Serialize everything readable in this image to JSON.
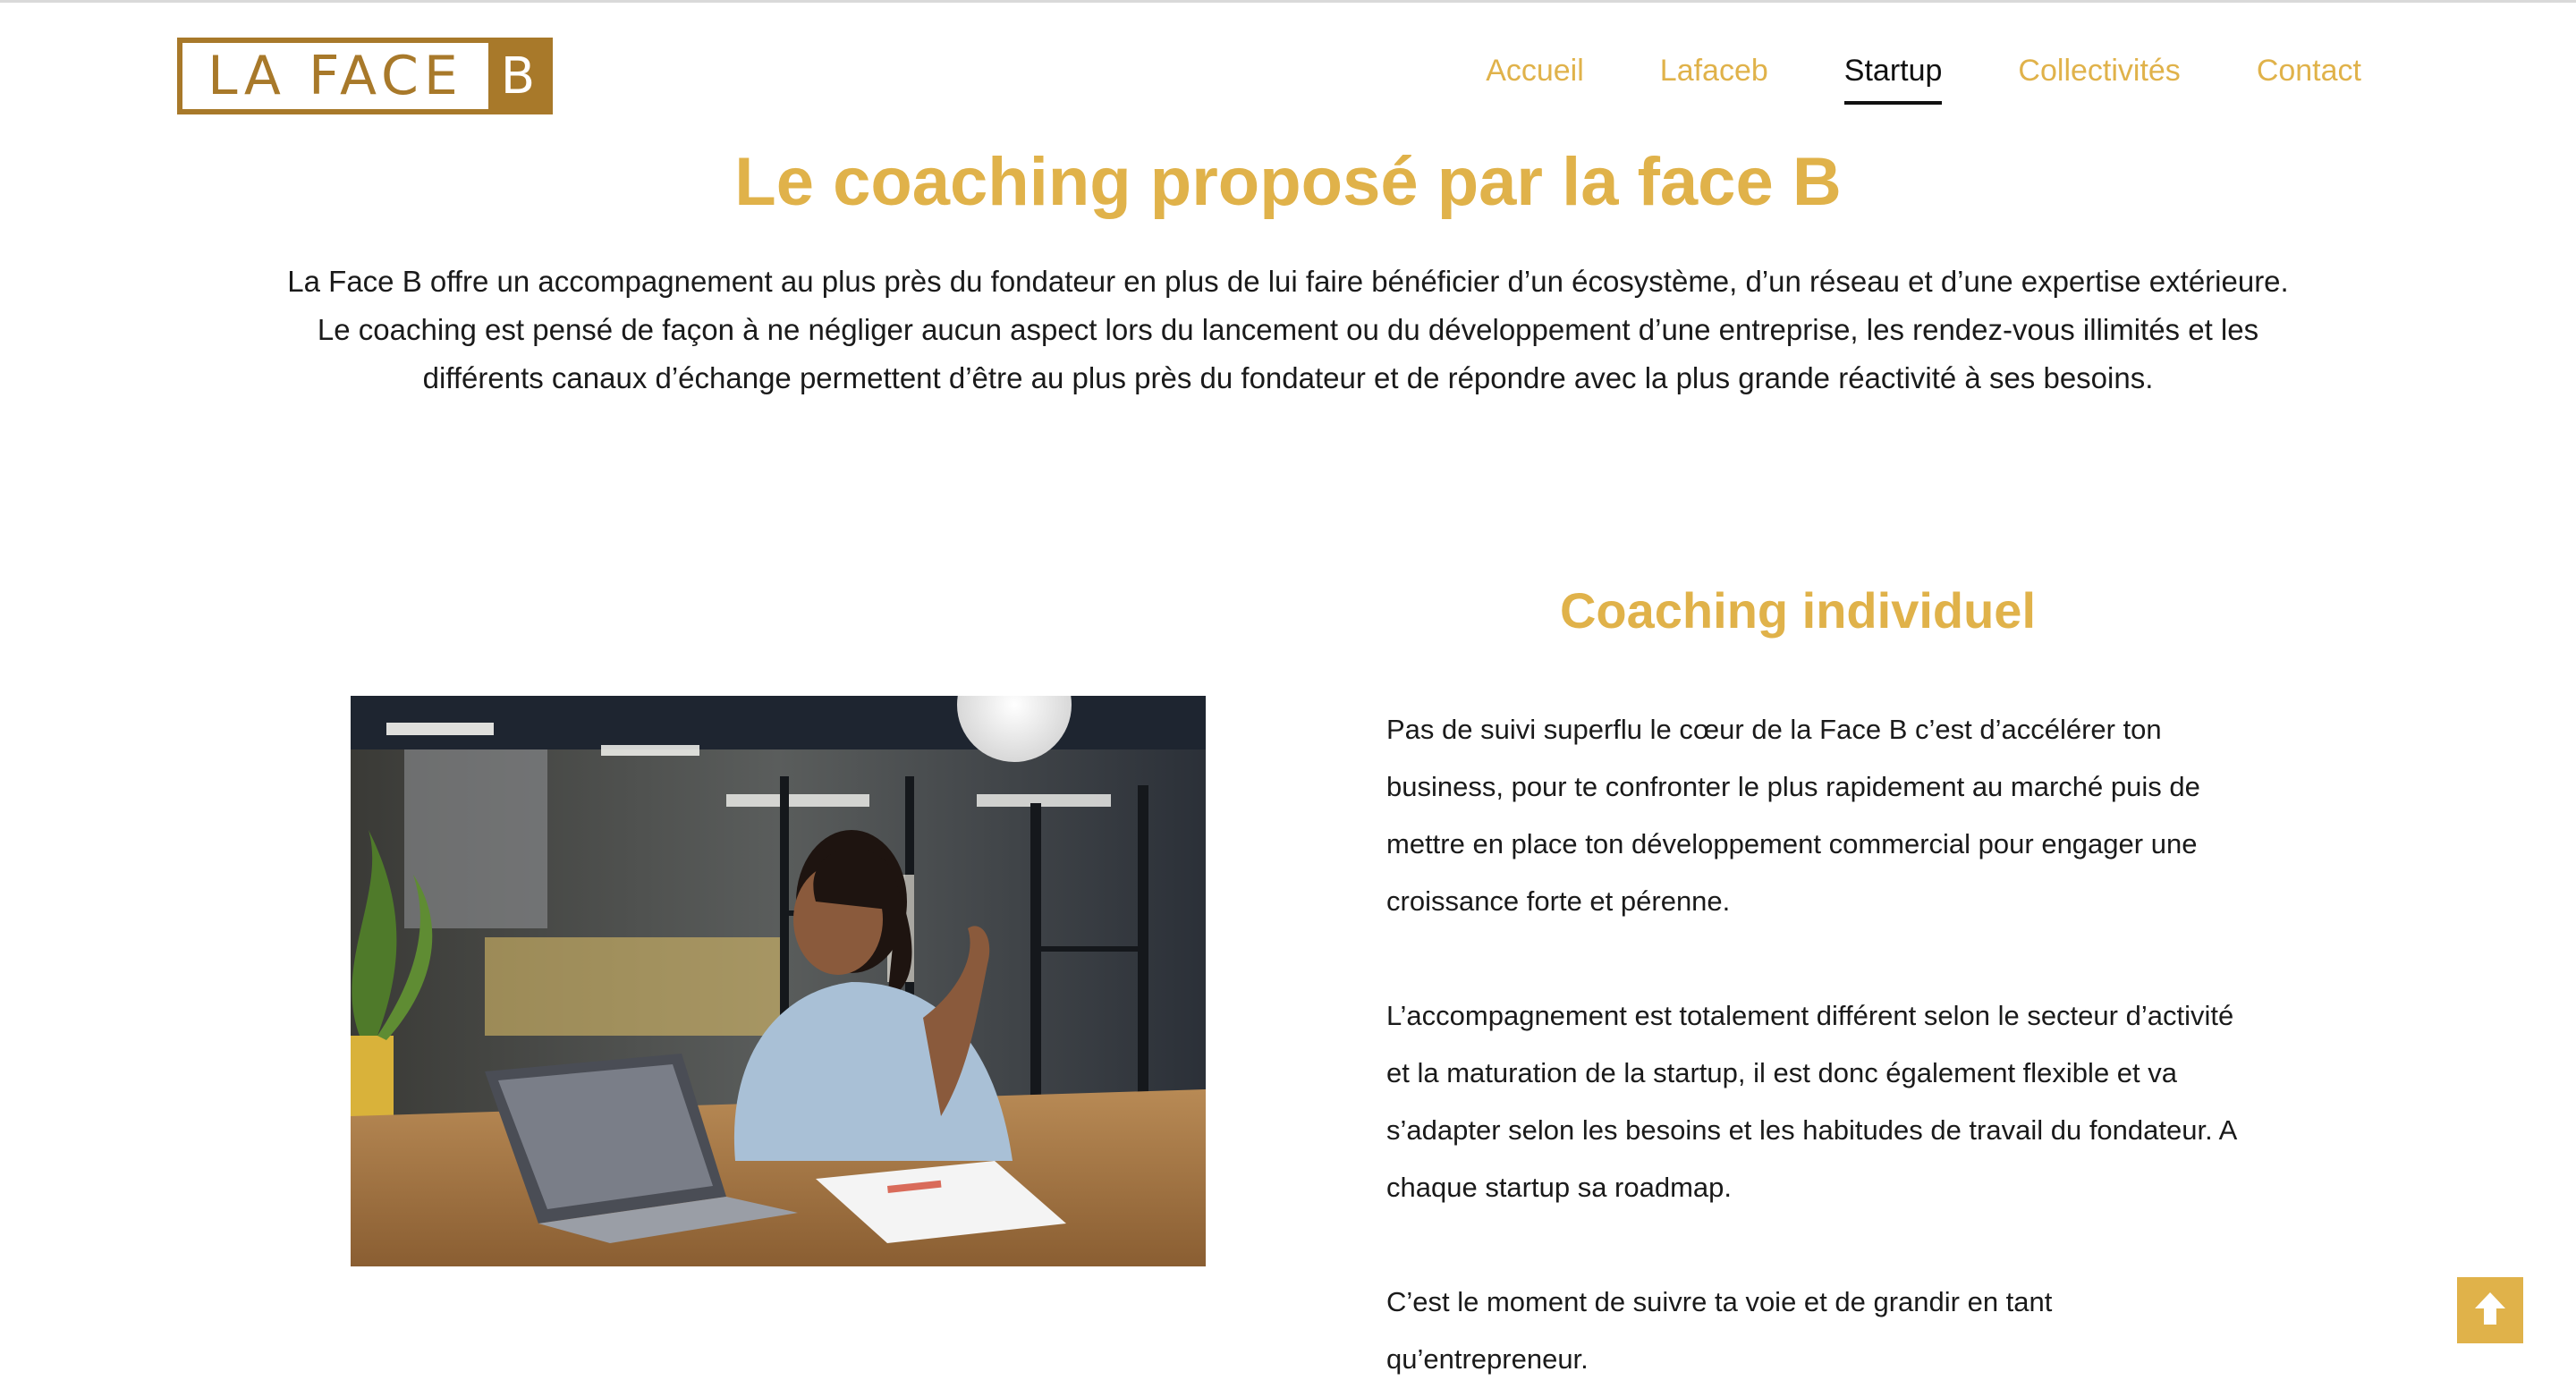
{
  "logo": {
    "text": "LA FACE",
    "letter": "B"
  },
  "nav": {
    "items": [
      {
        "label": "Accueil"
      },
      {
        "label": "Lafaceb"
      },
      {
        "label": "Startup"
      },
      {
        "label": "Collectivités"
      },
      {
        "label": "Contact"
      }
    ],
    "active": "Startup"
  },
  "hero": {
    "title": "Le coaching proposé par la face B",
    "intro": "La Face B offre un accompagnement au plus près du fondateur en plus de lui faire bénéficier d’un écosystème, d’un réseau et d’une expertise extérieure. Le coaching est pensé de façon à ne négliger aucun aspect lors du lancement ou du développement d’une entreprise, les rendez-vous illimités et les différents canaux d’échange permettent d’être au plus près du fondateur et de répondre avec la plus grande réactivité à ses besoins."
  },
  "section": {
    "title": "Coaching individuel",
    "paragraphs": [
      "Pas de suivi superflu le cœur de la Face B c’est d’accélérer ton business, pour te confronter le plus rapidement au marché puis de mettre en place ton développement commercial pour engager une croissance forte et pérenne.",
      "L’accompagnement est totalement différent selon le secteur d’activité et la maturation de la startup, il est  donc également flexible et va s’adapter selon les besoins et les habitudes de travail du fondateur. A chaque startup sa roadmap.",
      "C’est le moment de suivre ta voie et de grandir en tant qu’entrepreneur."
    ]
  },
  "colors": {
    "accent": "#e0b24a",
    "logo": "#a8792a"
  },
  "icons": {
    "scroll_top": "arrow-up-icon"
  }
}
